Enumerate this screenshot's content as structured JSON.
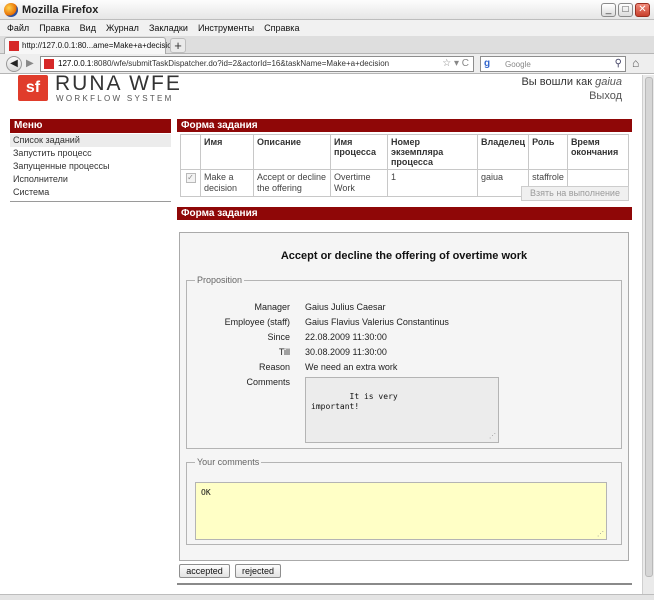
{
  "window": {
    "title": "Mozilla Firefox"
  },
  "menu": [
    "Файл",
    "Правка",
    "Вид",
    "Журнал",
    "Закладки",
    "Инструменты",
    "Справка"
  ],
  "tab": {
    "label": "http://127.0.0.1:80...ame=Make+a+decision"
  },
  "address": {
    "host": "127.0.0.1",
    "rest": ":8080/wfe/submitTaskDispatcher.do?id=2&actorId=16&taskName=Make+a+decision"
  },
  "search": {
    "engine": "g",
    "placeholder": "Google"
  },
  "logo": {
    "mark": "sf",
    "name": "RUNA WFE",
    "sub": "WORKFLOW SYSTEM"
  },
  "user": {
    "prefix": "Вы вошли как",
    "name": "gaiua",
    "logout": "Выход"
  },
  "sidebar": {
    "title": "Меню",
    "items": [
      "Список заданий",
      "Запустить процесс",
      "Запущенные процессы",
      "Исполнители",
      "Система"
    ]
  },
  "tasks": {
    "title": "Форма задания",
    "columns": [
      "",
      "Имя",
      "Описание",
      "Имя процесса",
      "Номер экземпляра процесса",
      "Владелец",
      "Роль",
      "Время окончания"
    ],
    "row": {
      "checkbox": "✓",
      "name": "Make a decision",
      "description": "Accept or decline the offering",
      "process": "Overtime Work",
      "instance": "1",
      "owner": "gaiua",
      "role": "staffrole",
      "end": ""
    },
    "take_button": "Взять на выполнение"
  },
  "form": {
    "title": "Форма задания",
    "heading": "Accept or decline the offering of overtime work",
    "proposition": {
      "legend": "Proposition",
      "fields": [
        {
          "label": "Manager",
          "value": "Gaius Julius Caesar"
        },
        {
          "label": "Employee (staff)",
          "value": "Gaius Flavius Valerius Constantinus"
        },
        {
          "label": "Since",
          "value": "22.08.2009 11:30:00"
        },
        {
          "label": "Till",
          "value": "30.08.2009 11:30:00"
        },
        {
          "label": "Reason",
          "value": "We need an extra work"
        },
        {
          "label": "Comments",
          "value": ""
        }
      ],
      "comments": "It is very\nimportant!"
    },
    "your_comments": {
      "legend": "Your comments",
      "value": "OK"
    },
    "accept_button": "accepted",
    "reject_button": "rejected"
  }
}
